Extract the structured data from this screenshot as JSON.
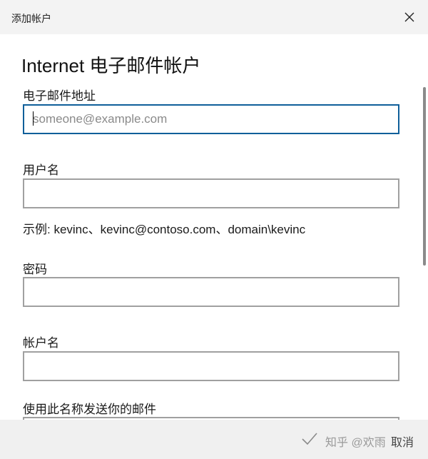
{
  "window": {
    "title": "添加帐户"
  },
  "form": {
    "heading": "Internet 电子邮件帐户",
    "email_label": "电子邮件地址",
    "email_placeholder": "someone@example.com",
    "email_value": "",
    "username_label": "用户名",
    "username_value": "",
    "username_hint": "示例: kevinc、kevinc@contoso.com、domain\\kevinc",
    "password_label": "密码",
    "password_value": "",
    "account_name_label": "帐户名",
    "account_name_value": "",
    "send_as_label": "使用此名称发送你的邮件",
    "send_as_value": ""
  },
  "footer": {
    "cancel_label": "取消",
    "watermark": "知乎 @欢雨"
  },
  "icons": {
    "close": "close-icon",
    "ok": "checkmark-icon"
  }
}
